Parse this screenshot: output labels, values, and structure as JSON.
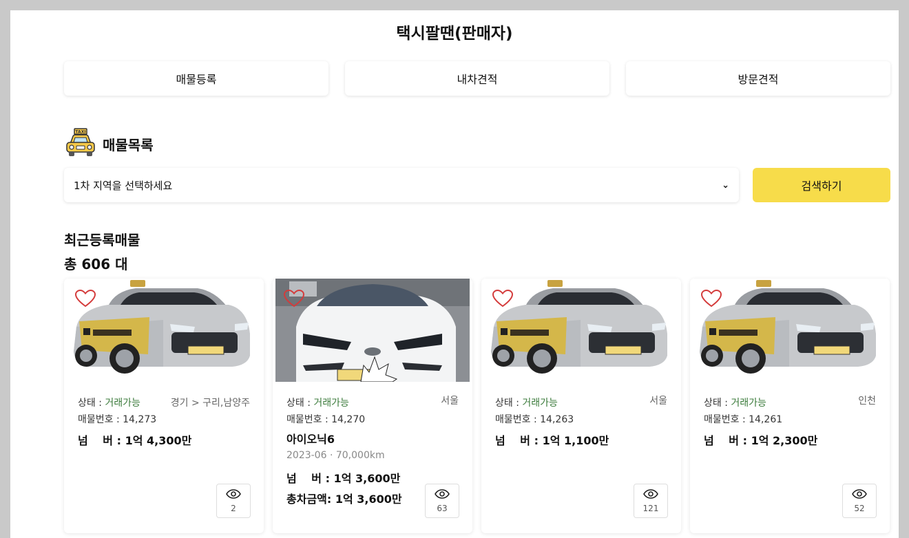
{
  "header": {
    "title": "택시팔땐(판매자)"
  },
  "tabs": [
    {
      "label": "매물등록"
    },
    {
      "label": "내차견적"
    },
    {
      "label": "방문견적"
    }
  ],
  "listing_section": {
    "icon": "taxi-icon",
    "title": "매물목록"
  },
  "filter": {
    "region_select_value": "1차 지역을 선택하세요",
    "search_label": "검색하기"
  },
  "recent": {
    "title": "최근등록매물",
    "total": "총 606 대"
  },
  "labels": {
    "status_prefix": "상태 : ",
    "number_prefix": "매물번호 : ",
    "price_prefix": "넘　 버 : ",
    "total_prefix": "총차금액: "
  },
  "cards": [
    {
      "image": "silver-sonata-taxi",
      "status": "거래가능",
      "region": "경기 > 구리,남양주",
      "number": "14,273",
      "plate_price": "1억 4,300만",
      "views": "2"
    },
    {
      "image": "white-ioniq6-photo",
      "status": "거래가능",
      "region": "서울",
      "number": "14,270",
      "model": "아이오닉6",
      "year": "2023-06",
      "mileage": "70,000km",
      "plate_price": "1억 3,600만",
      "total_price": "1억 3,600만",
      "views": "63"
    },
    {
      "image": "silver-sonata-taxi",
      "status": "거래가능",
      "region": "서울",
      "number": "14,263",
      "plate_price": "1억 1,100만",
      "views": "121"
    },
    {
      "image": "silver-sonata-taxi",
      "status": "거래가능",
      "region": "인천",
      "number": "14,261",
      "plate_price": "1억 2,300만",
      "views": "52"
    }
  ],
  "colors": {
    "accent_yellow": "#f7dc4a",
    "status_green": "#3a7a3a",
    "page_bg": "#c9c9c9"
  }
}
